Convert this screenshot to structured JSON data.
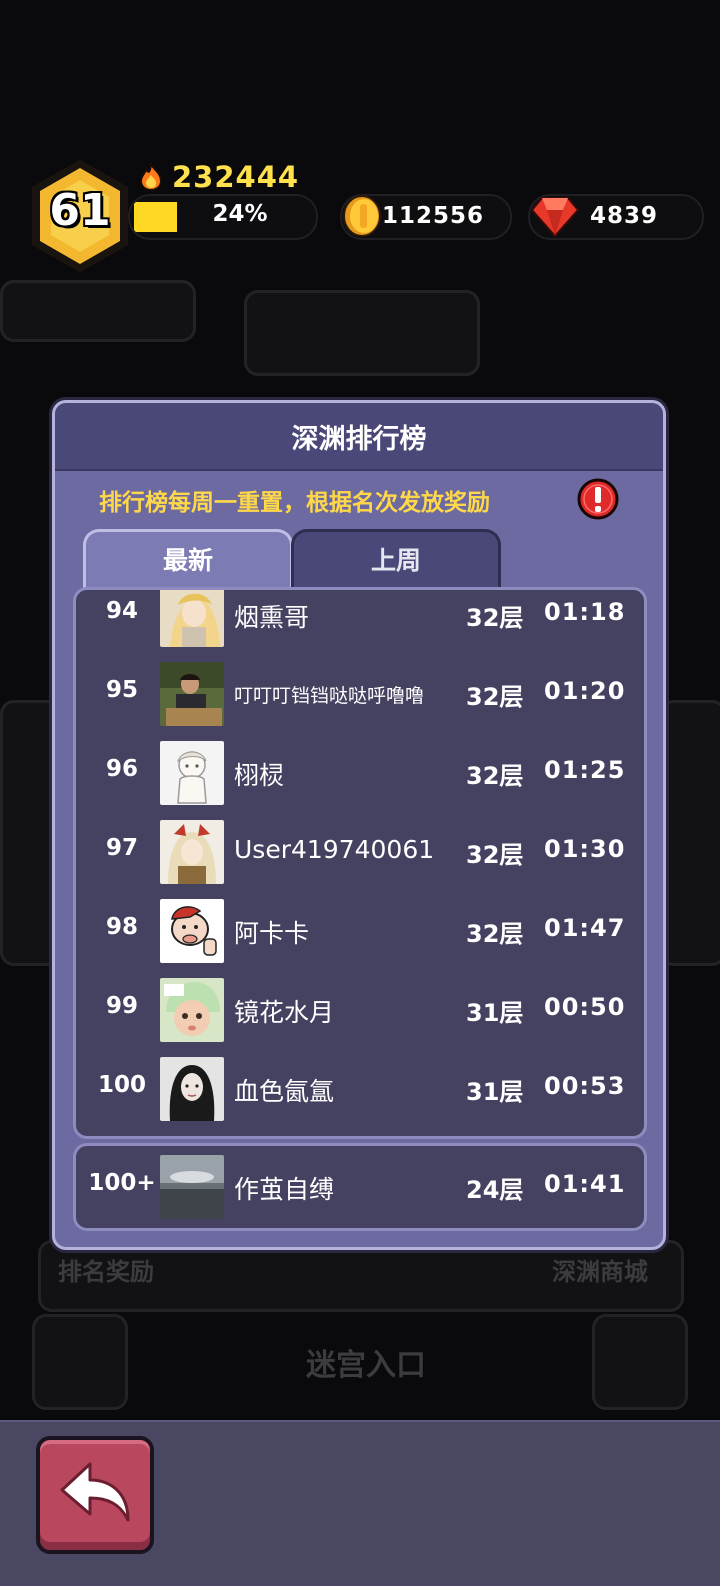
{
  "header": {
    "level": "61",
    "power": "232444",
    "xp_percent_label": "24%",
    "xp_fraction": 0.24,
    "coins": "112556",
    "gems": "4839"
  },
  "background": {
    "reward_label": "排名奖励",
    "shop_label": "深渊商城",
    "maze_label": "迷宫入口"
  },
  "panel": {
    "title": "深渊排行榜",
    "notice": "排行榜每周一重置，根据名次发放奖励",
    "tabs": [
      {
        "label": "最新",
        "active": true
      },
      {
        "label": "上周",
        "active": false
      }
    ],
    "rows": [
      {
        "rank": "94",
        "name": "烟熏哥",
        "floor": "32层",
        "time": "01:18"
      },
      {
        "rank": "95",
        "name": "叮叮叮铛铛哒哒呼噜噜",
        "floor": "32层",
        "time": "01:20"
      },
      {
        "rank": "96",
        "name": "栩棂",
        "floor": "32层",
        "time": "01:25"
      },
      {
        "rank": "97",
        "name": "User419740061",
        "floor": "32层",
        "time": "01:30"
      },
      {
        "rank": "98",
        "name": "阿卡卡",
        "floor": "32层",
        "time": "01:47"
      },
      {
        "rank": "99",
        "name": "镜花水月",
        "floor": "31层",
        "time": "00:50"
      },
      {
        "rank": "100",
        "name": "血色氤氲",
        "floor": "31层",
        "time": "00:53"
      }
    ],
    "self_row": {
      "rank": "100+",
      "name": "作茧自缚",
      "floor": "24层",
      "time": "01:41"
    }
  },
  "colors": {
    "panel": "#6c6aa0",
    "list": "#444260",
    "notice": "#ffd84a",
    "power": "#ffe04d",
    "xp_fill": "#ffd824",
    "back_button": "#b9475e"
  }
}
